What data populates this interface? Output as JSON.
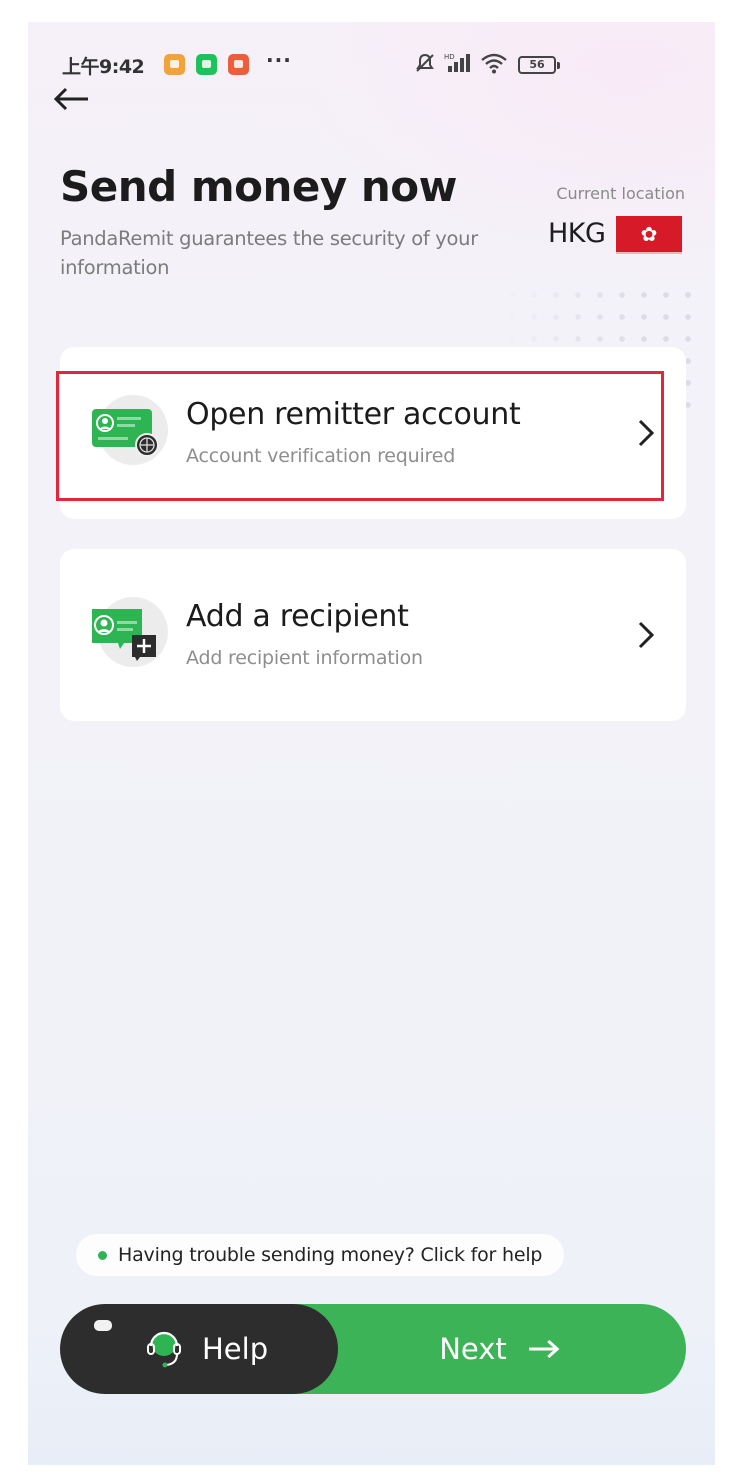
{
  "status_bar": {
    "time": "上午9:42",
    "more": "···",
    "battery": "56",
    "icons": [
      "app-notification-orange",
      "wechat-icon",
      "mi-app-icon",
      "mute-icon",
      "signal-icon",
      "wifi-icon",
      "battery-icon"
    ]
  },
  "header": {
    "back_icon": "arrow-left-icon",
    "title": "Send money now",
    "subtitle": "PandaRemit guarantees the security of your information",
    "location_label": "Current location",
    "location_code": "HKG",
    "flag_icon": "hong-kong-flag",
    "flag_glyph": "✿"
  },
  "cards": [
    {
      "title": "Open remitter account",
      "subtitle": "Account verification required",
      "icon": "id-card-globe-icon",
      "highlighted": true
    },
    {
      "title": "Add a recipient",
      "subtitle": "Add recipient information",
      "icon": "id-card-add-icon",
      "highlighted": false
    }
  ],
  "help_tip": {
    "text": "Having trouble sending money? Click for help"
  },
  "actions": {
    "help_label": "Help",
    "next_label": "Next"
  },
  "colors": {
    "accent_green": "#3cb356",
    "dark_button": "#2c2d2c",
    "highlight_red": "#e2263e",
    "flag_red": "#d71a28"
  }
}
